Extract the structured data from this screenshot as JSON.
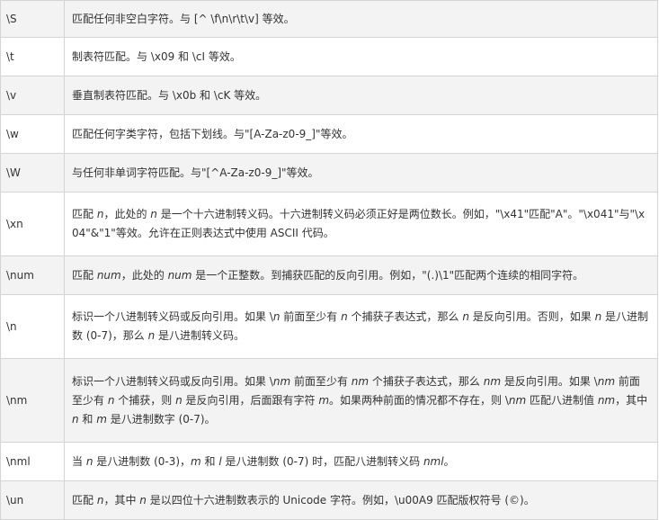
{
  "rows": [
    {
      "pattern": "\\S",
      "desc": [
        {
          "t": "匹配任何非空白字符。与 [^ \\f\\n\\r\\t\\v] 等效。"
        }
      ]
    },
    {
      "pattern": "\\t",
      "desc": [
        {
          "t": "制表符匹配。与 \\x09 和 \\cI 等效。"
        }
      ]
    },
    {
      "pattern": "\\v",
      "desc": [
        {
          "t": "垂直制表符匹配。与 \\x0b 和 \\cK 等效。"
        }
      ]
    },
    {
      "pattern": "\\w",
      "desc": [
        {
          "t": "匹配任何字类字符，包括下划线。与\"[A-Za-z0-9_]\"等效。"
        }
      ]
    },
    {
      "pattern": "\\W",
      "desc": [
        {
          "t": "与任何非单词字符匹配。与\"[^A-Za-z0-9_]\"等效。"
        }
      ]
    },
    {
      "pattern": "\\xn",
      "desc": [
        {
          "t": "匹配 "
        },
        {
          "t": "n",
          "i": true
        },
        {
          "t": "，此处的 "
        },
        {
          "t": "n",
          "i": true
        },
        {
          "t": " 是一个十六进制转义码。十六进制转义码必须正好是两位数长。例如，\"\\x41\"匹配\"A\"。\"\\x041\"与\"\\x04\"&\"1\"等效。允许在正则表达式中使用 ASCII 代码。"
        }
      ]
    },
    {
      "pattern": "\\num",
      "desc": [
        {
          "t": "匹配 "
        },
        {
          "t": "num",
          "i": true
        },
        {
          "t": "，此处的 "
        },
        {
          "t": "num",
          "i": true
        },
        {
          "t": " 是一个正整数。到捕获匹配的反向引用。例如，\"(.)\\1\"匹配两个连续的相同字符。"
        }
      ]
    },
    {
      "pattern": "\\n",
      "desc": [
        {
          "t": "标识一个八进制转义码或反向引用。如果 \\"
        },
        {
          "t": "n",
          "i": true
        },
        {
          "t": " 前面至少有 "
        },
        {
          "t": "n",
          "i": true
        },
        {
          "t": " 个捕获子表达式，那么 "
        },
        {
          "t": "n",
          "i": true
        },
        {
          "t": " 是反向引用。否则，如果 "
        },
        {
          "t": "n",
          "i": true
        },
        {
          "t": " 是八进制数 (0-7)，那么 "
        },
        {
          "t": "n",
          "i": true
        },
        {
          "t": " 是八进制转义码。"
        }
      ]
    },
    {
      "pattern": "\\nm",
      "desc": [
        {
          "t": "标识一个八进制转义码或反向引用。如果 \\"
        },
        {
          "t": "nm",
          "i": true
        },
        {
          "t": " 前面至少有 "
        },
        {
          "t": "nm",
          "i": true
        },
        {
          "t": " 个捕获子表达式，那么 "
        },
        {
          "t": "nm",
          "i": true
        },
        {
          "t": " 是反向引用。如果 \\"
        },
        {
          "t": "nm",
          "i": true
        },
        {
          "t": " 前面至少有 "
        },
        {
          "t": "n",
          "i": true
        },
        {
          "t": " 个捕获，则 "
        },
        {
          "t": "n",
          "i": true
        },
        {
          "t": " 是反向引用，后面跟有字符 "
        },
        {
          "t": "m",
          "i": true
        },
        {
          "t": "。如果两种前面的情况都不存在，则 \\"
        },
        {
          "t": "nm",
          "i": true
        },
        {
          "t": " 匹配八进制值 "
        },
        {
          "t": "nm",
          "i": true
        },
        {
          "t": "，其中 "
        },
        {
          "t": "n",
          "i": true
        },
        {
          "t": " 和 "
        },
        {
          "t": "m",
          "i": true
        },
        {
          "t": " 是八进制数字 (0-7)。"
        }
      ]
    },
    {
      "pattern": "\\nml",
      "desc": [
        {
          "t": "当 "
        },
        {
          "t": "n",
          "i": true
        },
        {
          "t": " 是八进制数 (0-3)，"
        },
        {
          "t": "m",
          "i": true
        },
        {
          "t": " 和 "
        },
        {
          "t": "l",
          "i": true
        },
        {
          "t": " 是八进制数 (0-7) 时，匹配八进制转义码 "
        },
        {
          "t": "nml",
          "i": true
        },
        {
          "t": "。"
        }
      ]
    },
    {
      "pattern": "\\un",
      "desc": [
        {
          "t": "匹配 "
        },
        {
          "t": "n",
          "i": true
        },
        {
          "t": "，其中 "
        },
        {
          "t": "n",
          "i": true
        },
        {
          "t": " 是以四位十六进制数表示的 Unicode 字符。例如，\\u00A9 匹配版权符号 (©)。"
        }
      ]
    }
  ]
}
